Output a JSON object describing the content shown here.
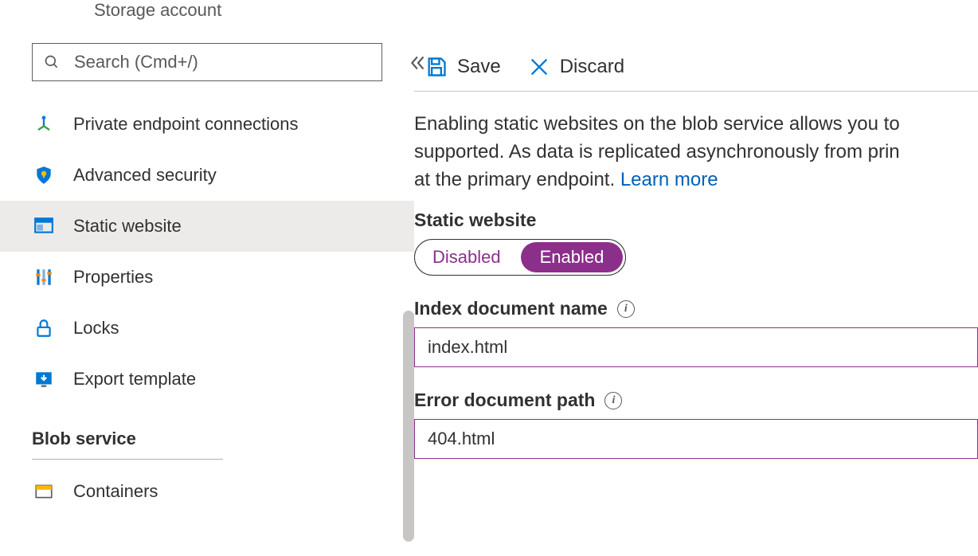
{
  "header": {
    "subtitle": "Storage account"
  },
  "search": {
    "placeholder": "Search (Cmd+/)"
  },
  "sidebar": {
    "items": [
      {
        "label": "Private endpoint connections",
        "icon": "endpoint-icon"
      },
      {
        "label": "Advanced security",
        "icon": "shield-icon"
      },
      {
        "label": "Static website",
        "icon": "static-website-icon",
        "selected": true
      },
      {
        "label": "Properties",
        "icon": "properties-icon"
      },
      {
        "label": "Locks",
        "icon": "lock-icon"
      },
      {
        "label": "Export template",
        "icon": "export-icon"
      }
    ],
    "section_blob": "Blob service",
    "blob_items": [
      {
        "label": "Containers",
        "icon": "container-icon"
      }
    ]
  },
  "toolbar": {
    "save_label": "Save",
    "discard_label": "Discard"
  },
  "main": {
    "description_part1": "Enabling static websites on the blob service allows you to",
    "description_part2": "supported. As data is replicated asynchronously from prin",
    "description_part3": "at the primary endpoint. ",
    "learn_more": "Learn more",
    "static_website_label": "Static website",
    "toggle_off": "Disabled",
    "toggle_on": "Enabled",
    "index_label": "Index document name",
    "index_value": "index.html",
    "error_label": "Error document path",
    "error_value": "404.html"
  }
}
